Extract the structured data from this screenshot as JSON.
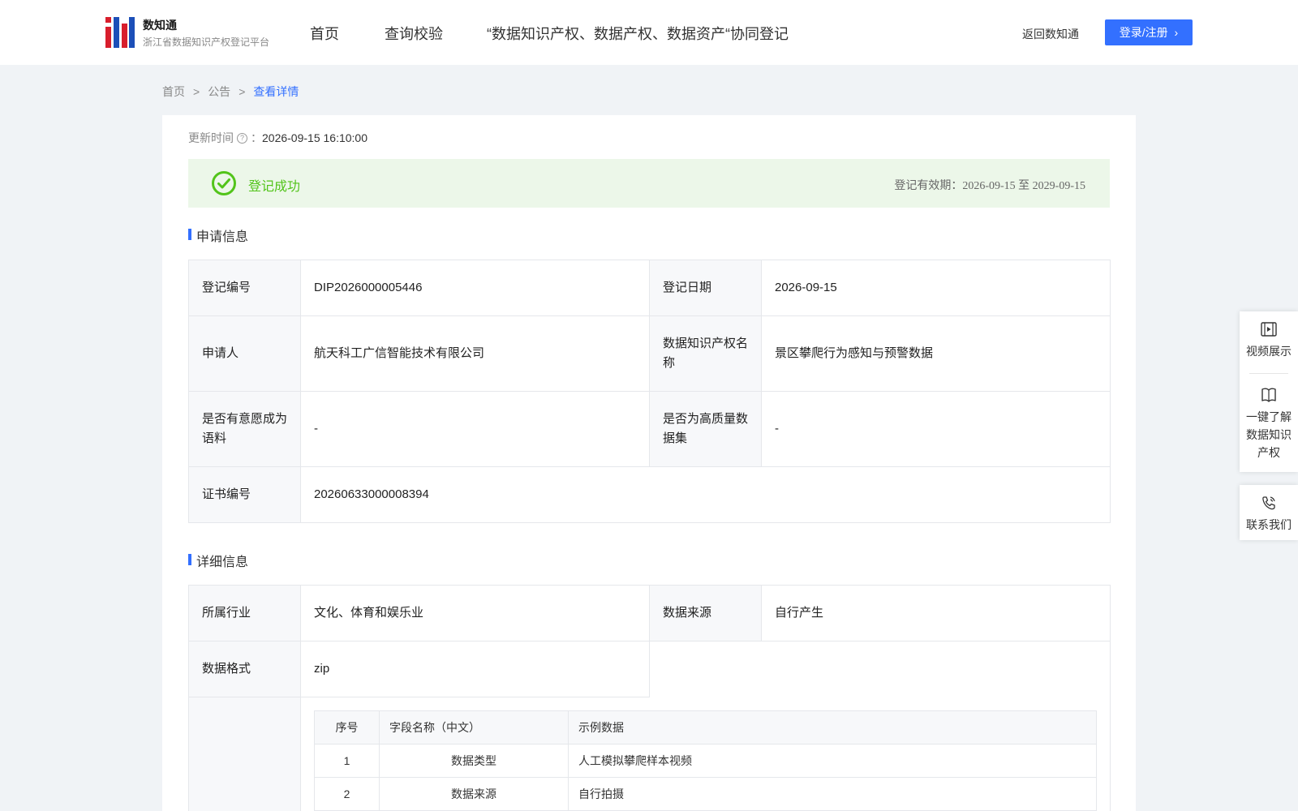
{
  "header": {
    "brand_title": "数知通",
    "brand_subtitle": "浙江省数据知识产权登记平台",
    "nav": [
      "首页",
      "查询校验",
      "“数据知识产权、数据产权、数据资产“协同登记"
    ],
    "back_link": "返回数知通",
    "login_label": "登录/注册",
    "accent_color": "#3370ff"
  },
  "breadcrumb": {
    "items": [
      "首页",
      "公告"
    ],
    "separator": ">",
    "current": "查看详情"
  },
  "update": {
    "label": "更新时间",
    "colon": "：",
    "value": "2026-09-15 16:10:00"
  },
  "status": {
    "text": "登记成功",
    "validity": "登记有效期：2026-09-15 至 2029-09-15",
    "color": "#52c41a"
  },
  "apply_section": {
    "title": "申请信息",
    "rows": [
      {
        "l1": "登记编号",
        "v1": "DIP2026000005446",
        "l2": "登记日期",
        "v2": "2026-09-15"
      },
      {
        "l1": "申请人",
        "v1": "航天科工广信智能技术有限公司",
        "l2": "数据知识产权名称",
        "v2": "景区攀爬行为感知与预警数据"
      },
      {
        "l1": "是否有意愿成为语料",
        "v1": "-",
        "l2": "是否为高质量数据集",
        "v2": "-"
      }
    ],
    "cert": {
      "label": "证书编号",
      "value": "20260633000008394"
    }
  },
  "detail_section": {
    "title": "详细信息",
    "industry": {
      "label": "所属行业",
      "value": "文化、体育和娱乐业"
    },
    "source": {
      "label": "数据来源",
      "value": "自行产生"
    },
    "format": {
      "label": "数据格式",
      "value": "zip"
    },
    "fields": {
      "headers": [
        "序号",
        "字段名称（中文）",
        "示例数据"
      ],
      "rows": [
        {
          "no": "1",
          "name": "数据类型",
          "sample": "人工模拟攀爬样本视频"
        },
        {
          "no": "2",
          "name": "数据来源",
          "sample": "自行拍摄"
        }
      ]
    }
  },
  "float_panel": {
    "video": "视频展示",
    "learn": "一键了解数据知识产权",
    "contact": "联系我们"
  }
}
